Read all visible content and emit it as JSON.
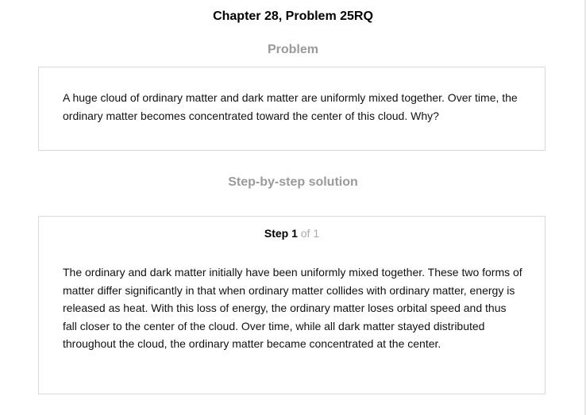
{
  "header": {
    "chapter_title": "Chapter 28, Problem 25RQ"
  },
  "problem": {
    "heading": "Problem",
    "text": "A huge cloud of ordinary matter and dark matter are uniformly mixed together. Over time, the ordinary matter becomes concentrated toward the center of this cloud. Why?"
  },
  "solution": {
    "heading": "Step-by-step solution",
    "step": {
      "label": "Step 1",
      "of_text": "of 1"
    },
    "text": "The ordinary and dark matter initially have been uniformly mixed together. These two forms of matter differ significantly in that when ordinary matter collides with ordinary matter, energy is released as heat. With this loss of energy, the ordinary matter loses orbital speed and thus fall closer to the center of the cloud. Over time, while all dark matter stayed distributed throughout the cloud, the ordinary matter became concentrated at the center."
  },
  "colors": {
    "heading_gray": "#9a9a9a",
    "card_border": "#d9d9d9",
    "step_of_gray": "#aaaaaa"
  }
}
